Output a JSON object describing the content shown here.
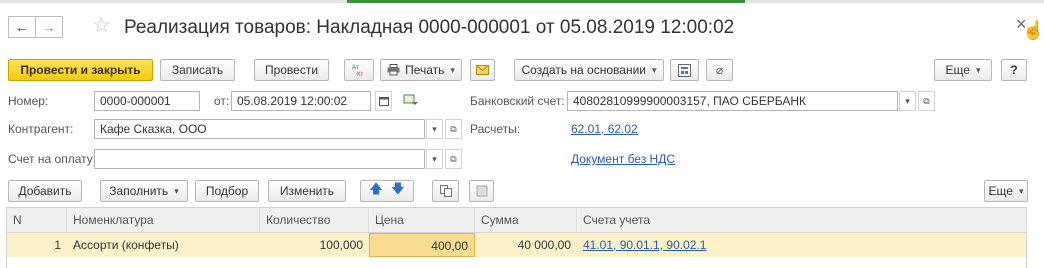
{
  "window": {
    "title": "Реализация товаров: Накладная 0000-000001 от 05.08.2019 12:00:02",
    "back_glyph": "←",
    "forward_glyph": "→",
    "star_glyph": "☆",
    "close_glyph": "×",
    "cursor_glyph": "☝"
  },
  "toolbar": {
    "post_and_close": "Провести и закрыть",
    "save": "Записать",
    "post": "Провести",
    "print": "Печать",
    "create_based_on": "Создать на основании",
    "more": "Еще",
    "help": "?"
  },
  "form": {
    "number_label": "Номер:",
    "number_value": "0000-000001",
    "date_label": "от:",
    "date_value": "05.08.2019 12:00:02",
    "bank_label": "Банковский счет:",
    "bank_value": "40802810999900003157, ПАО СБЕРБАНК",
    "counterparty_label": "Контрагент:",
    "counterparty_value": "Кафе Сказка, ООО",
    "settlements_label": "Расчеты:",
    "settlements_link": "62.01, 62.02",
    "invoice_label": "Счет на оплату:",
    "invoice_value": "",
    "vat_link": "Документ без НДС"
  },
  "table_toolbar": {
    "add": "Добавить",
    "fill": "Заполнить",
    "pick": "Подбор",
    "change": "Изменить",
    "more": "Еще"
  },
  "table": {
    "columns": [
      "N",
      "Номенклатура",
      "Количество",
      "Цена",
      "Сумма",
      "Счета учета"
    ],
    "rows": [
      {
        "n": "1",
        "item": "Ассорти (конфеты)",
        "qty": "100,000",
        "price": "400,00",
        "sum": "40 000,00",
        "accounts": "41.01, 90.01.1, 90.02.1"
      }
    ]
  },
  "colors": {
    "primary_button": "#f7c910",
    "link": "#2a5caa",
    "selected_row": "#fbf1c8"
  }
}
